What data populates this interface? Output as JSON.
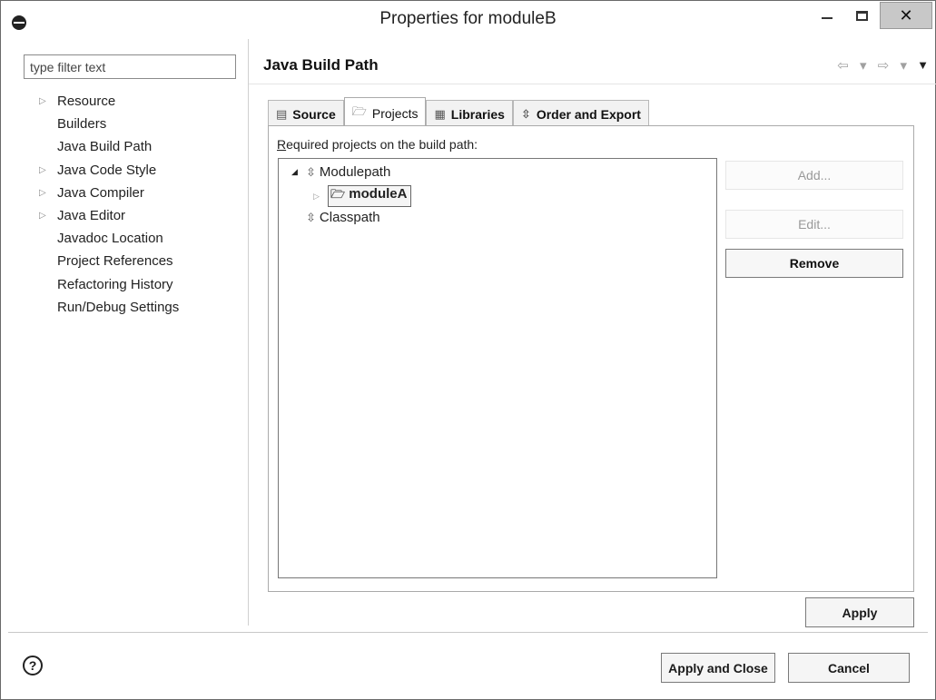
{
  "window": {
    "title": "Properties for moduleB",
    "close_glyph": "✕"
  },
  "left": {
    "filter_placeholder": "type filter text",
    "items": [
      {
        "label": "Resource",
        "expandable": true
      },
      {
        "label": "Builders",
        "expandable": false
      },
      {
        "label": "Java Build Path",
        "expandable": false
      },
      {
        "label": "Java Code Style",
        "expandable": true
      },
      {
        "label": "Java Compiler",
        "expandable": true
      },
      {
        "label": "Java Editor",
        "expandable": true
      },
      {
        "label": "Javadoc Location",
        "expandable": false
      },
      {
        "label": "Project References",
        "expandable": false
      },
      {
        "label": "Refactoring History",
        "expandable": false
      },
      {
        "label": "Run/Debug Settings",
        "expandable": false
      }
    ]
  },
  "header": {
    "title": "Java Build Path",
    "nav_back": "⇦ ▾",
    "nav_forward": "⇨ ▾",
    "menu": "▼"
  },
  "tabs": [
    {
      "label": "Source",
      "icon": "source-folder-icon",
      "glyph": "▤"
    },
    {
      "label": "Projects",
      "icon": "project-folder-icon",
      "glyph": "🗁",
      "active": true
    },
    {
      "label": "Libraries",
      "icon": "libraries-icon",
      "glyph": "▦"
    },
    {
      "label": "Order and Export",
      "icon": "order-export-icon",
      "glyph": "⇳"
    }
  ],
  "panel": {
    "required_label_first": "R",
    "required_label_rest": "equired projects on the build path:",
    "tree": {
      "modulepath": "Modulepath",
      "moduleA": "moduleA",
      "classpath": "Classpath"
    },
    "buttons": {
      "add": "Add...",
      "edit": "Edit...",
      "remove": "Remove"
    }
  },
  "footer": {
    "apply": "Apply",
    "apply_and_close": "Apply and Close",
    "cancel": "Cancel",
    "help": "?"
  }
}
